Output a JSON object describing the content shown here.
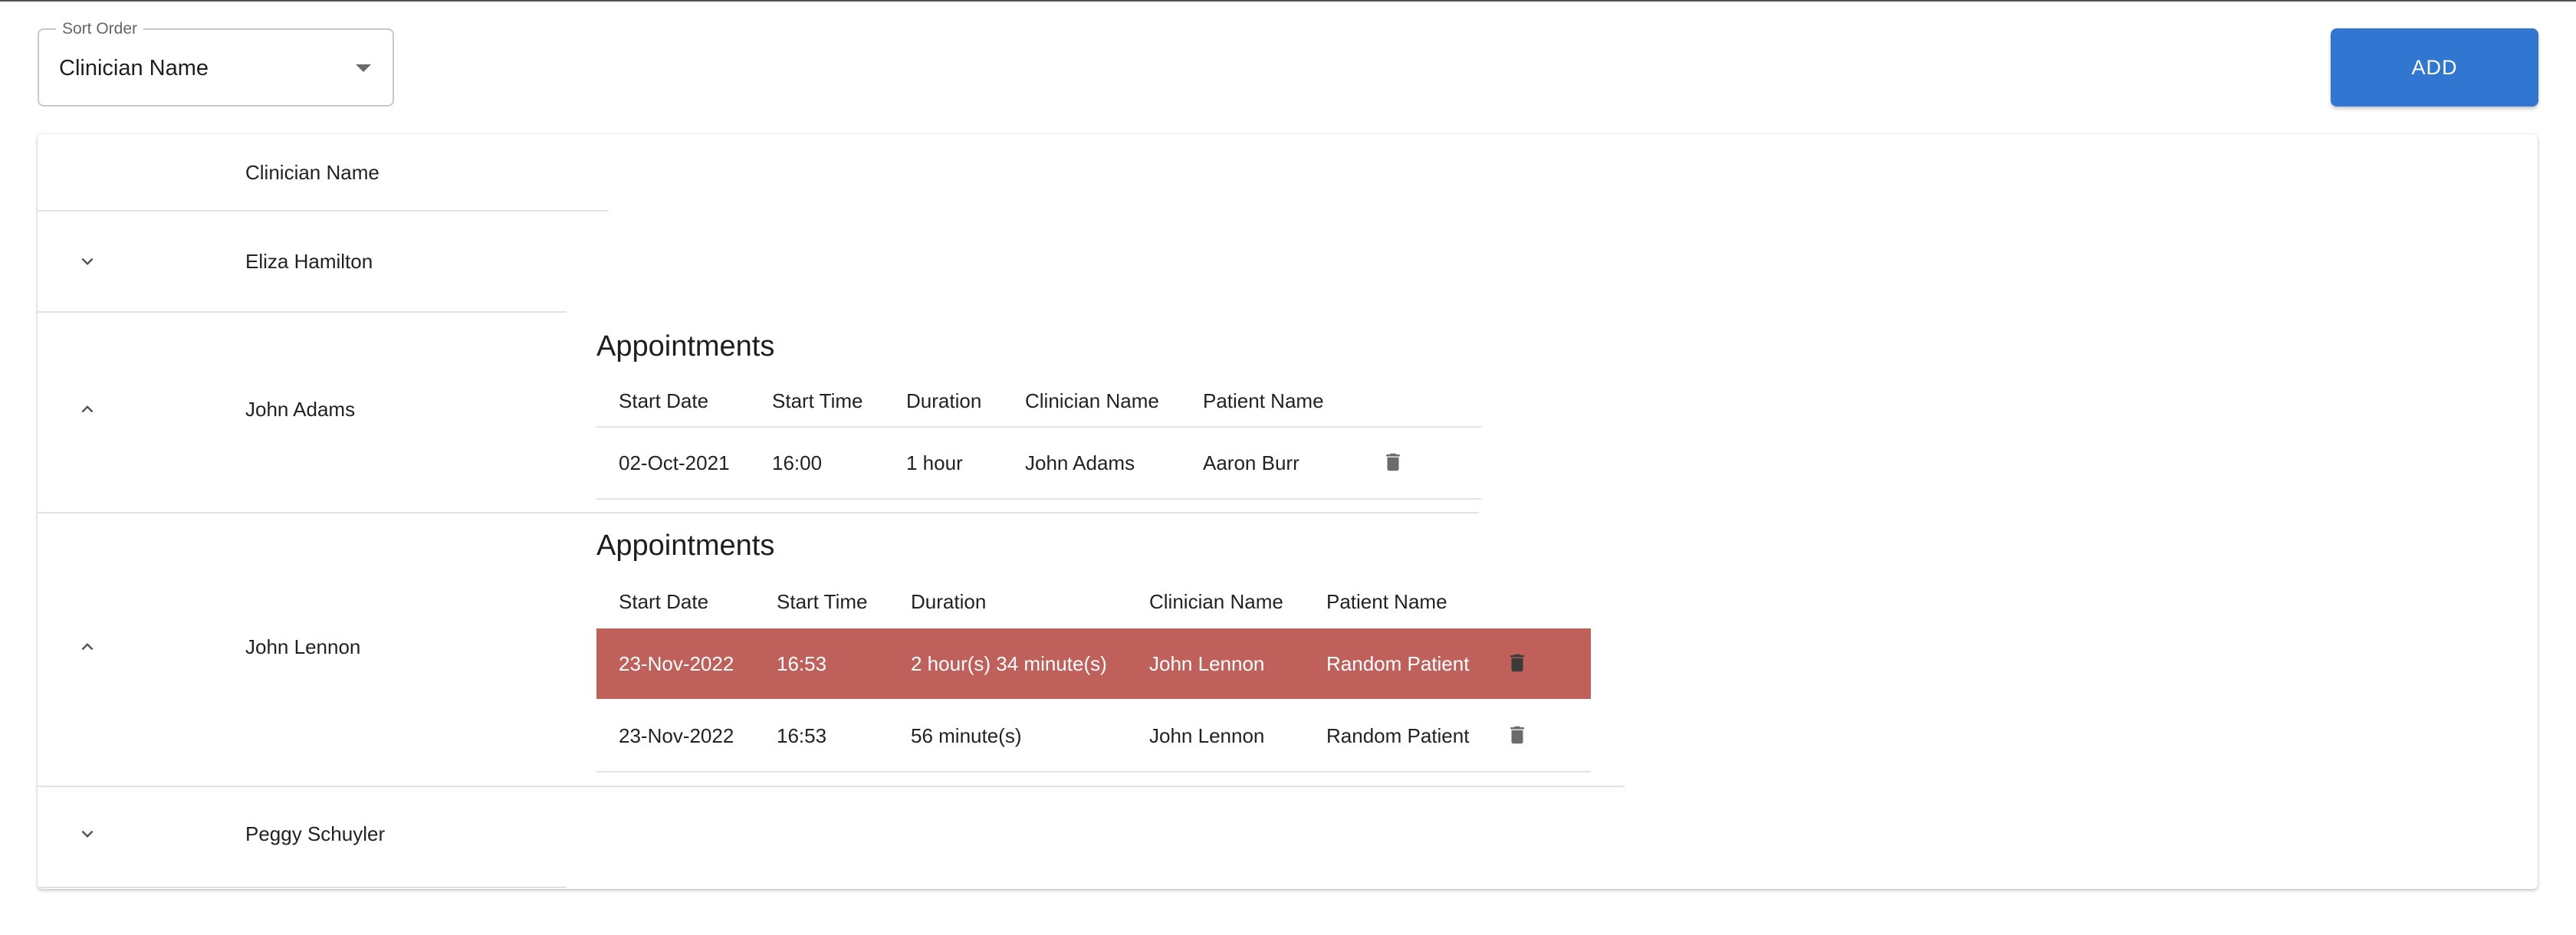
{
  "sort": {
    "label": "Sort Order",
    "value": "Clinician Name"
  },
  "add_button": "ADD",
  "table": {
    "header": "Clinician Name",
    "rows": [
      {
        "name": "Eliza Hamilton",
        "expanded": false
      },
      {
        "name": "John Adams",
        "expanded": true,
        "appointments_title": "Appointments",
        "columns": [
          "Start Date",
          "Start Time",
          "Duration",
          "Clinician Name",
          "Patient Name"
        ],
        "appointments": [
          {
            "start_date": "02-Oct-2021",
            "start_time": "16:00",
            "duration": "1 hour",
            "clinician": "John Adams",
            "patient": "Aaron Burr",
            "highlighted": false
          }
        ]
      },
      {
        "name": "John Lennon",
        "expanded": true,
        "appointments_title": "Appointments",
        "columns": [
          "Start Date",
          "Start Time",
          "Duration",
          "Clinician Name",
          "Patient Name"
        ],
        "appointments": [
          {
            "start_date": "23-Nov-2022",
            "start_time": "16:53",
            "duration": "2 hour(s) 34 minute(s)",
            "clinician": "John Lennon",
            "patient": "Random Patient",
            "highlighted": true
          },
          {
            "start_date": "23-Nov-2022",
            "start_time": "16:53",
            "duration": "56 minute(s)",
            "clinician": "John Lennon",
            "patient": "Random Patient",
            "highlighted": false
          }
        ]
      },
      {
        "name": "Peggy Schuyler",
        "expanded": false
      }
    ]
  },
  "icons": {
    "collapsed": "chevron-down-icon",
    "expanded": "chevron-up-icon",
    "delete": "trash-icon",
    "dropdown": "caret-down-icon"
  },
  "colors": {
    "primary": "#3176d0",
    "highlight_row": "#c0605b",
    "icon_gray": "#6b6b6b"
  }
}
